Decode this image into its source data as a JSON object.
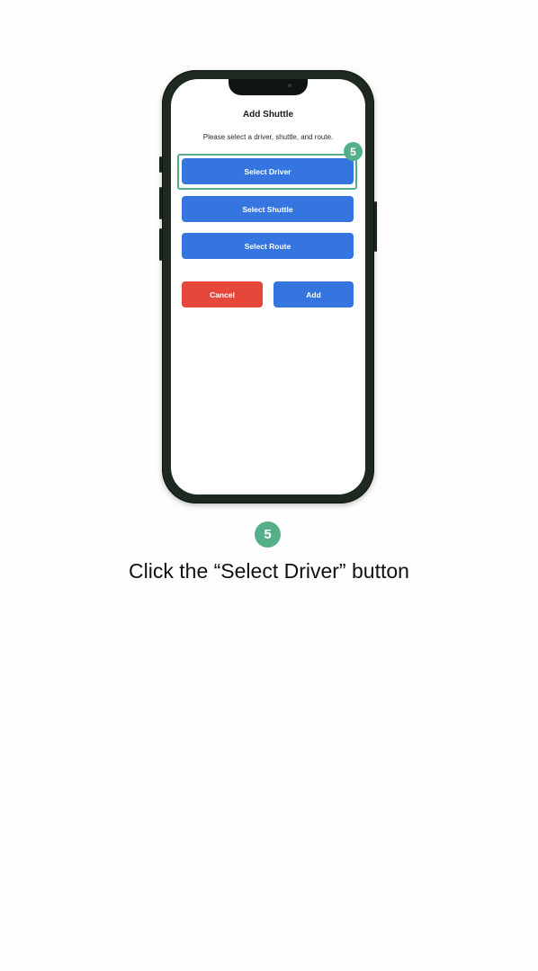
{
  "screen": {
    "title": "Add Shuttle",
    "subtitle": "Please select a driver, shuttle, and route.",
    "buttons": {
      "select_driver": "Select Driver",
      "select_shuttle": "Select Shuttle",
      "select_route": "Select Route",
      "cancel": "Cancel",
      "add": "Add"
    }
  },
  "step": {
    "number": "5",
    "instruction": "Click the “Select Driver” button"
  },
  "colors": {
    "primary": "#3575df",
    "danger": "#e5473a",
    "highlight": "#55b08a",
    "phone_frame": "#1e2a20"
  }
}
